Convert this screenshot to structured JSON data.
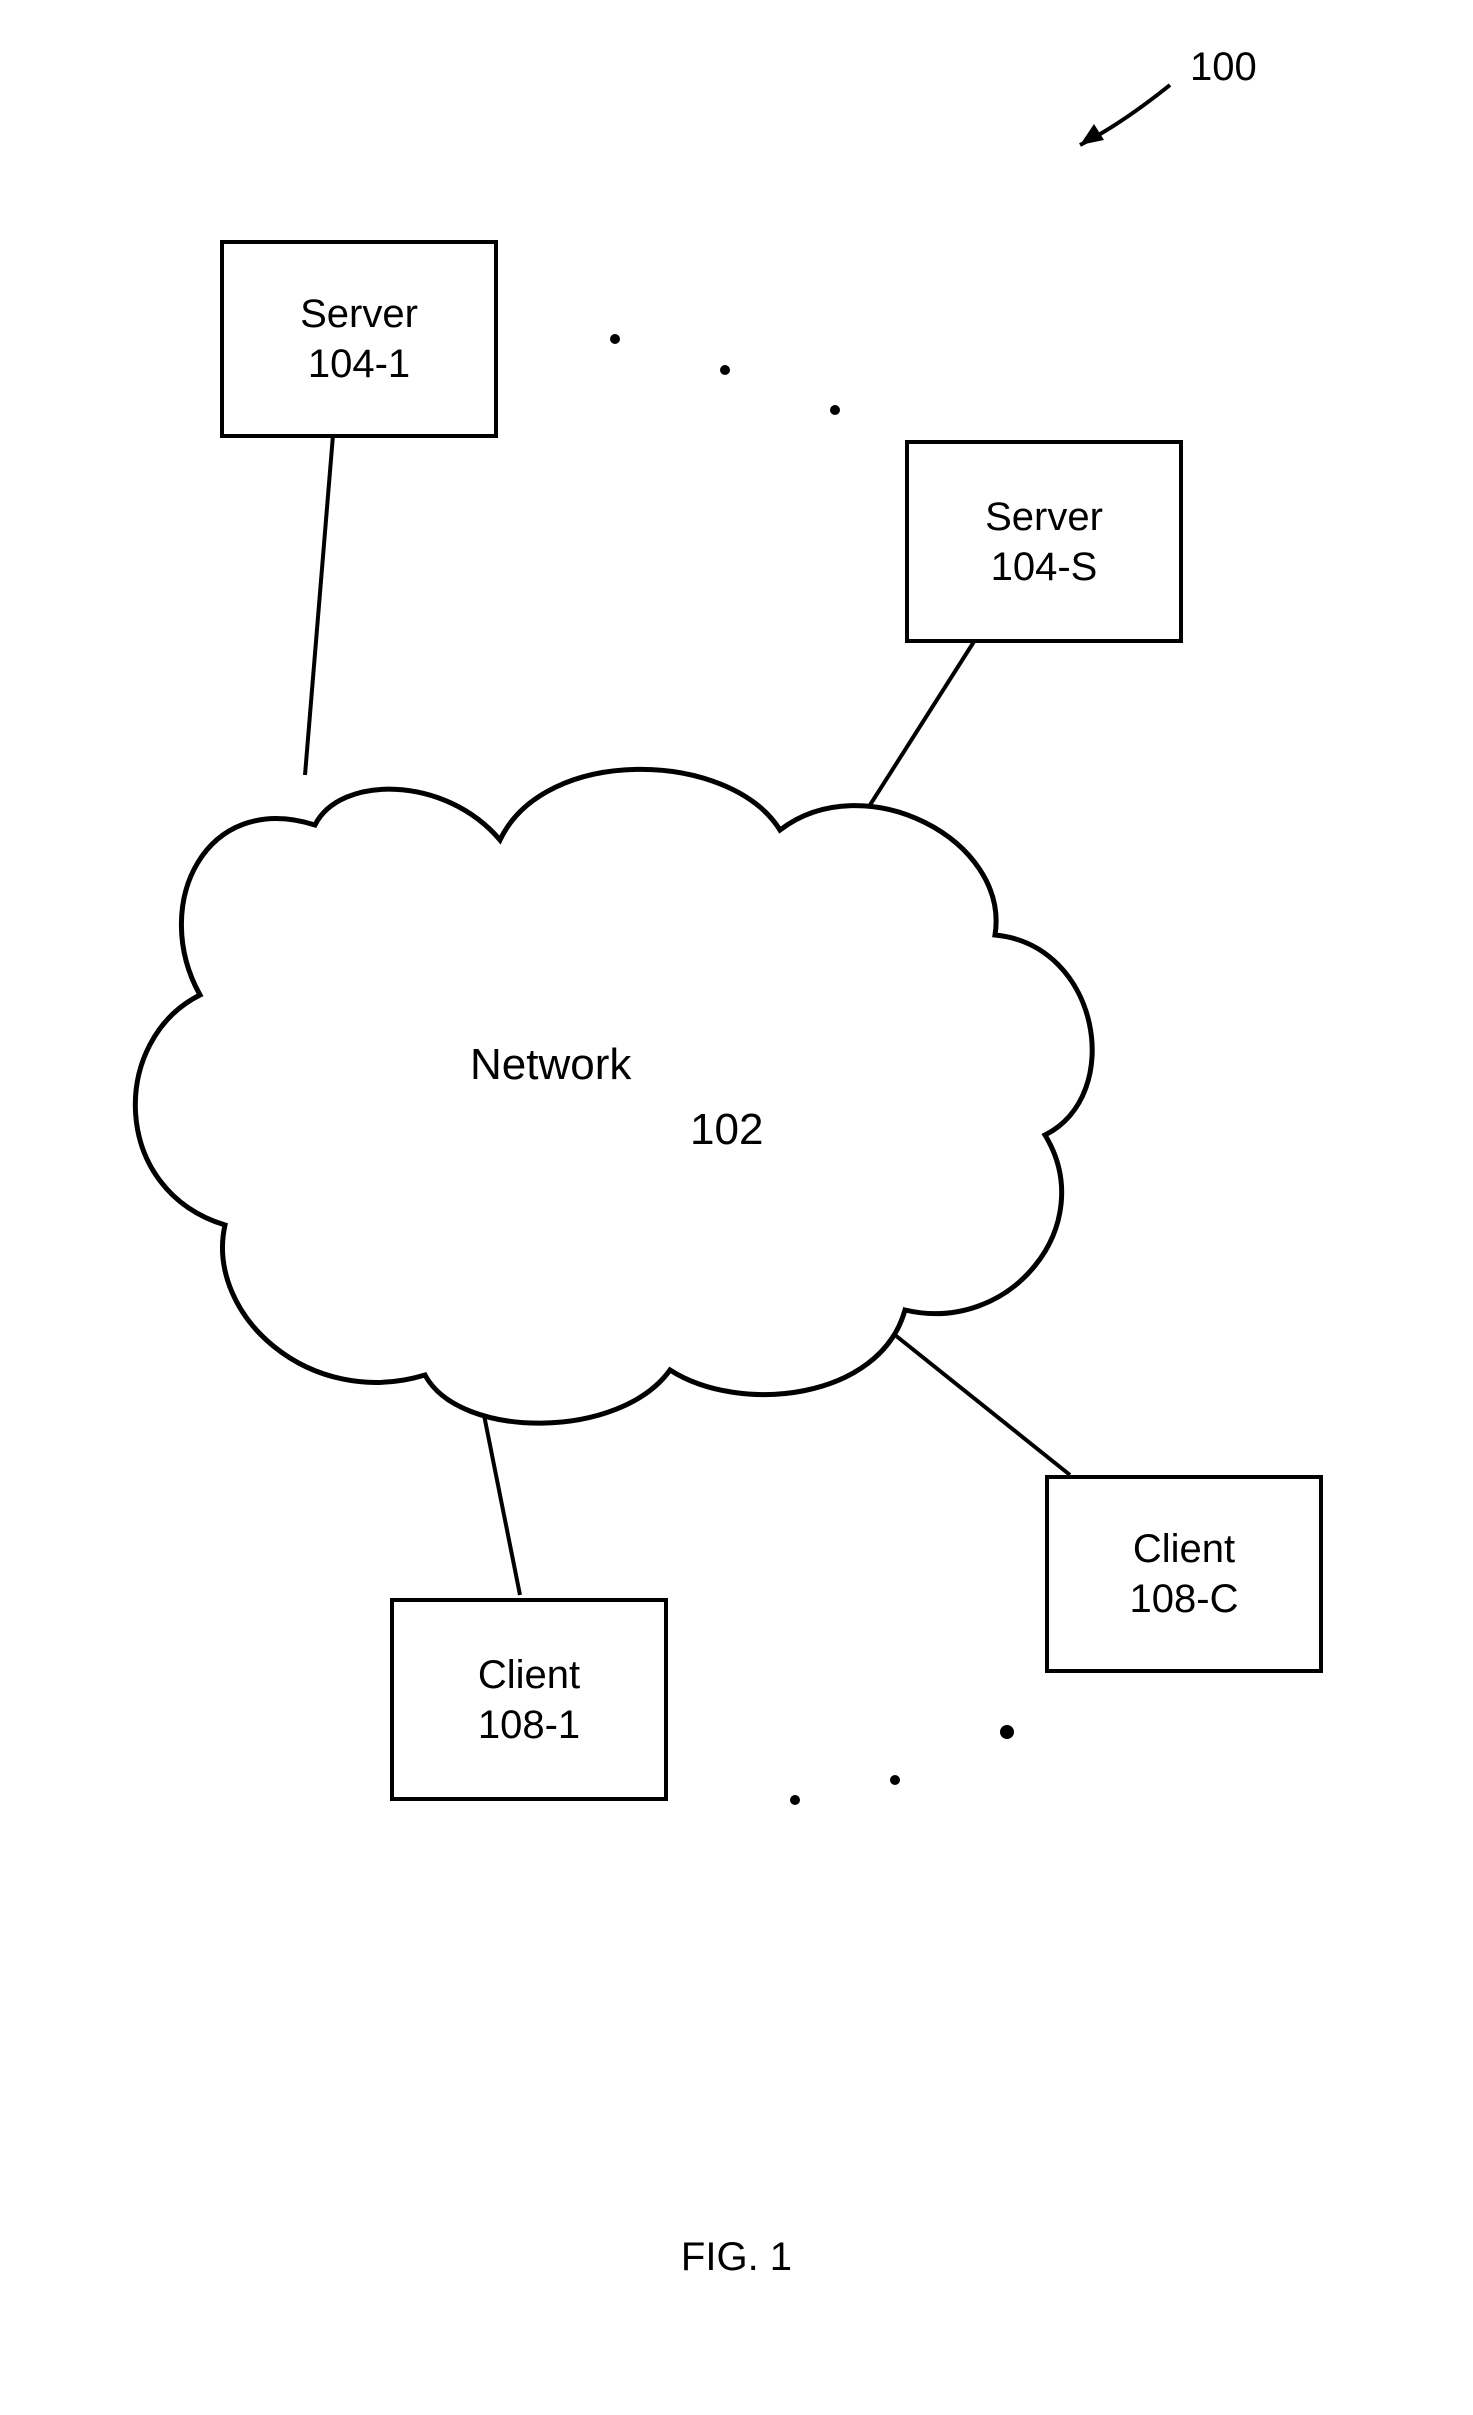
{
  "figure_id": "100",
  "figure_label": "FIG. 1",
  "network": {
    "label": "Network",
    "id": "102"
  },
  "servers": {
    "item1": {
      "label": "Server",
      "id": "104-1"
    },
    "itemS": {
      "label": "Server",
      "id": "104-S"
    }
  },
  "clients": {
    "item1": {
      "label": "Client",
      "id": "108-1"
    },
    "itemC": {
      "label": "Client",
      "id": "108-C"
    }
  }
}
